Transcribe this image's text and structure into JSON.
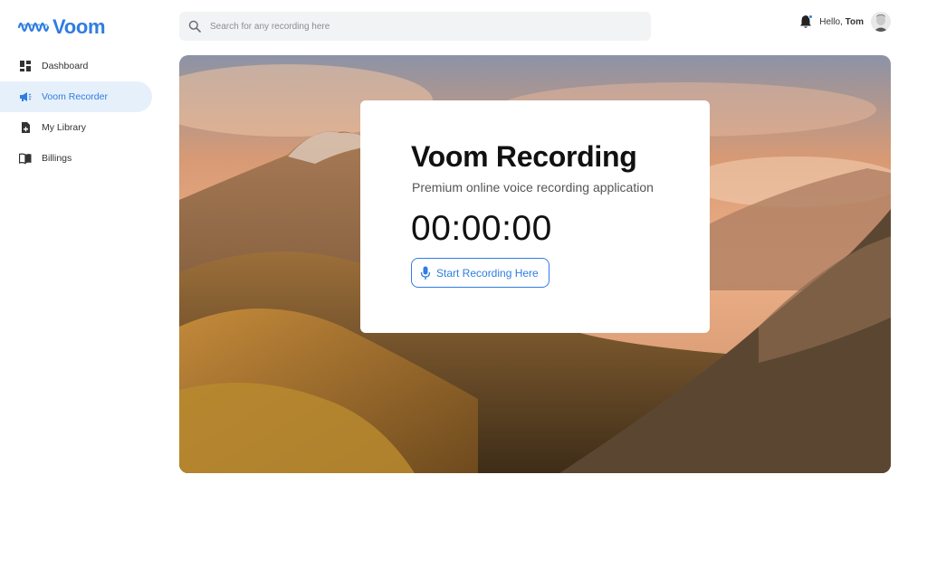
{
  "brand": {
    "name": "Voom",
    "color": "#2f7de1"
  },
  "sidebar": {
    "items": [
      {
        "label": "Dashboard",
        "icon": "dashboard-icon",
        "active": false
      },
      {
        "label": "Voom Recorder",
        "icon": "megaphone-icon",
        "active": true
      },
      {
        "label": "My Library",
        "icon": "library-icon",
        "active": false
      },
      {
        "label": "Billings",
        "icon": "book-icon",
        "active": false
      }
    ]
  },
  "header": {
    "search_placeholder": "Search for any recording here",
    "greeting": "Hello,",
    "user_name": "Tom"
  },
  "card": {
    "title": "Voom Recording",
    "subtitle": "Premium online voice recording application",
    "timer": "00:00:00",
    "button_label": "Start Recording Here"
  },
  "colors": {
    "accent": "#2f7de1",
    "active_bg": "#e5f0fb",
    "search_bg": "#f2f3f5"
  }
}
